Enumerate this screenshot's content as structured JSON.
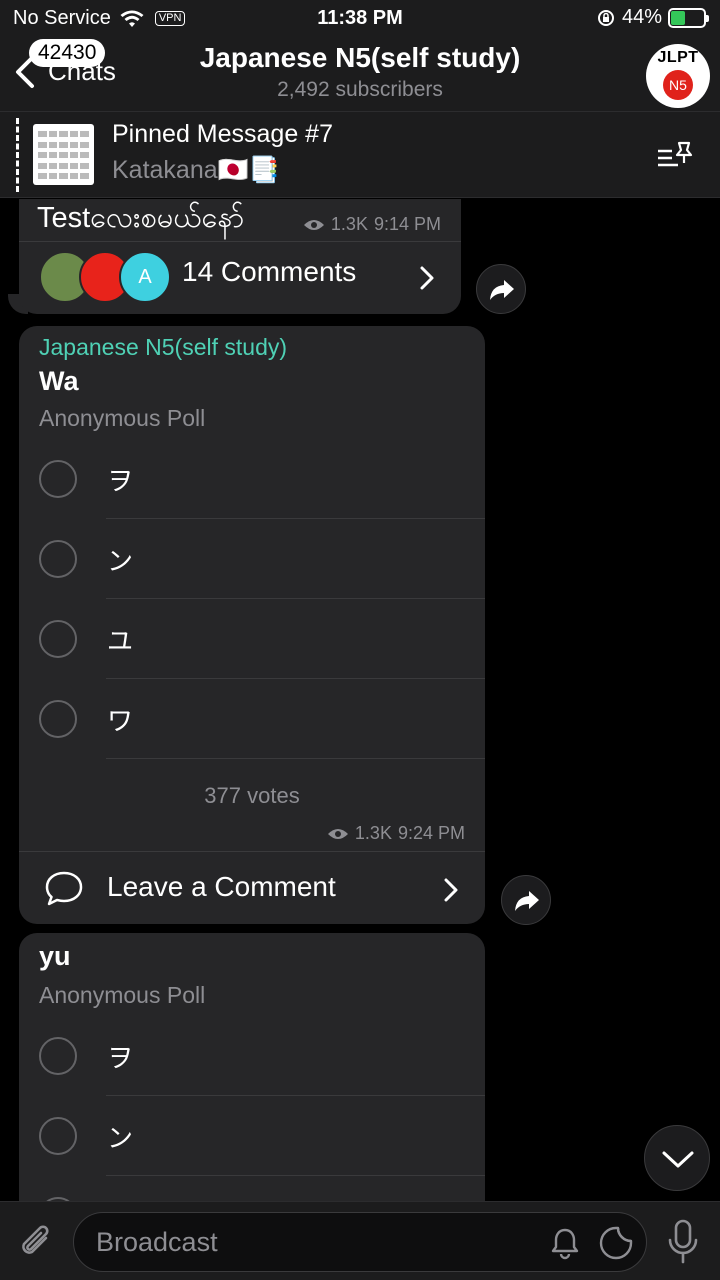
{
  "status_bar": {
    "carrier": "No Service",
    "vpn": "VPN",
    "time": "11:38 PM",
    "battery_percent": "44%",
    "battery_level": 0.44
  },
  "header": {
    "back_badge": "42430",
    "back_label": "Chats",
    "title": "Japanese N5(self study)",
    "subtitle": "2,492 subscribers",
    "avatar_top": "JLPT",
    "avatar_bottom": "N5"
  },
  "pinned": {
    "title": "Pinned Message #7",
    "text": "Katakana🇯🇵📑"
  },
  "messages": [
    {
      "text": "Testလေးစမယ်နော်",
      "views": "1.3K",
      "time": "9:14 PM",
      "comments_label": "14 Comments",
      "commenter_initial": "A"
    },
    {
      "author": "Japanese N5(self study)",
      "question": "Wa",
      "poll_type": "Anonymous Poll",
      "options": [
        "ヲ",
        "ン",
        "ユ",
        "ワ"
      ],
      "votes": "377 votes",
      "views": "1.3K",
      "time": "9:24 PM",
      "comment_label": "Leave a Comment"
    },
    {
      "question": "yu",
      "poll_type": "Anonymous Poll",
      "options": [
        "ヲ",
        "ン"
      ]
    }
  ],
  "input": {
    "placeholder": "Broadcast"
  },
  "colors": {
    "accent": "#4fd1b5",
    "bubble": "#262628",
    "bar": "#1c1c1d"
  }
}
